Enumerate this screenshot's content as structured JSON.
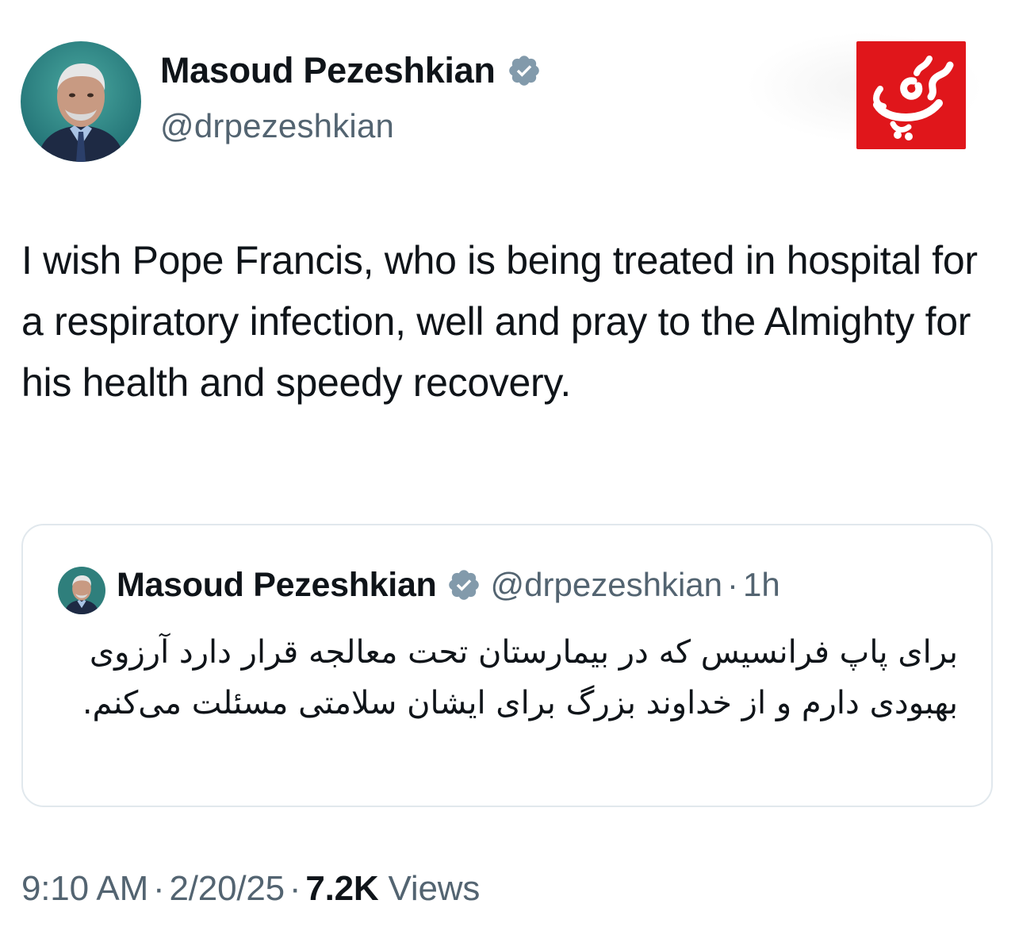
{
  "author": {
    "display_name": "Masoud Pezeshkian",
    "handle": "@drpezeshkian",
    "verified": true
  },
  "tweet": {
    "text": "I wish Pope Francis, who is being treated in hospital for a respiratory infection, well and pray to the Almighty for his health and speedy recovery."
  },
  "quoted_tweet": {
    "display_name": "Masoud Pezeshkian",
    "handle": "@drpezeshkian",
    "separator": "·",
    "time": "1h",
    "text": "برای پاپ فرانسیس که در بیمارستان تحت معالجه قرار دارد آرزوی بهبودی دارم و از خداوند بزرگ برای ایشان سلامتی مسئلت می‌کنم."
  },
  "meta": {
    "time": "9:10 AM",
    "separator": "·",
    "date": "2/20/25",
    "views_count": "7.2K",
    "views_label": "Views"
  },
  "watermark": {
    "text": "میهن",
    "background_color": "#e0161b"
  },
  "colors": {
    "text_primary": "#0f1419",
    "text_secondary": "#536471",
    "border": "#e1e8ed",
    "verified_badge": "#829aab"
  },
  "icons": {
    "verified": "verified-badge-icon",
    "avatar": "profile-photo",
    "watermark": "brand-logo"
  }
}
